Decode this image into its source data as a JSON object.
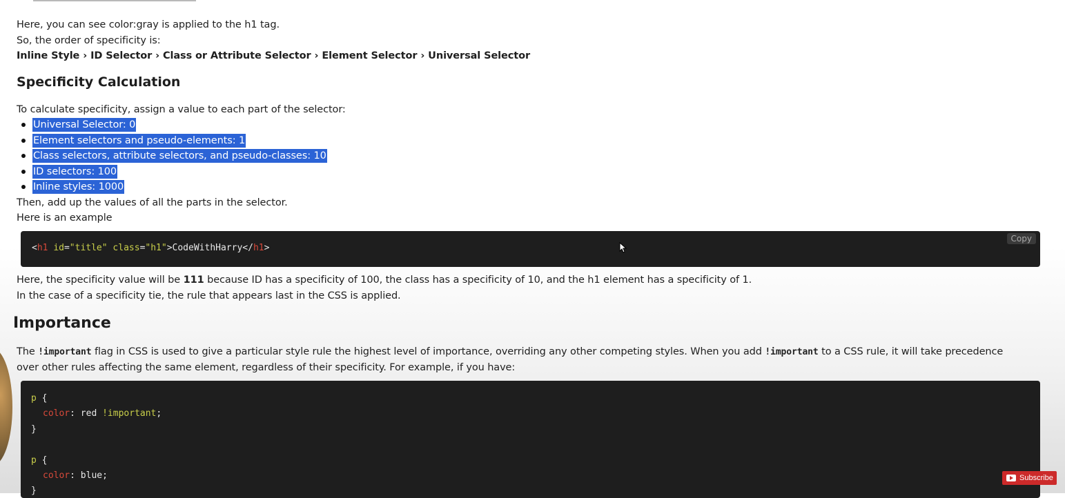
{
  "intro": {
    "line1": "Here, you can see color:gray is applied to the h1 tag.",
    "line2": "So, the order of specificity is:",
    "order": "Inline Style › ID Selector › Class or Attribute Selector › Element Selector › Universal Selector"
  },
  "specificity": {
    "heading": "Specificity Calculation",
    "intro": "To calculate specificity, assign a value to each part of the selector:",
    "items": [
      "Universal Selector: 0",
      "Element selectors and pseudo-elements: 1",
      "Class selectors, attribute selectors, and pseudo-classes: 10",
      "ID selectors: 100",
      "Inline styles: 1000"
    ],
    "then": "Then, add up the values of all the parts in the selector.",
    "example_label": "Here is an example"
  },
  "code_example": {
    "lt": "<",
    "tag": "h1",
    "attr_id": "id",
    "eq1": "=",
    "val_id": "\"title\"",
    "attr_class": "class",
    "eq2": "=",
    "val_class": "\"h1\"",
    "gt": ">",
    "text": "CodeWithHarry",
    "close_open": "</",
    "close_tag": "h1",
    "close_gt": ">",
    "copy_label": "Copy"
  },
  "explanation": {
    "part1": "Here, the specificity value will be ",
    "value": "111",
    "part2": " because ID has a specificity of 100, the class has a specificity of 10, and the h1 element has a specificity of 1.",
    "tie": "In the case of a specificity tie, the rule that appears last in the CSS is applied."
  },
  "importance": {
    "heading": "Importance",
    "p1a": "The ",
    "code1": "!important",
    "p1b": " flag in CSS is used to give a particular style rule the highest level of importance, overriding any other competing styles. When you add ",
    "code2": "!important",
    "p1c": " to a CSS rule, it will take precedence",
    "p2": "over other rules affecting the same element, regardless of their specificity. For example, if you have:"
  },
  "code_importance": {
    "l1_sel": "p",
    "l1_brace": " {",
    "l2_prop": "color",
    "l2_colon": ": red ",
    "l2_imp": "!important",
    "l2_semi": ";",
    "l3": "}",
    "l5_sel": "p",
    "l5_brace": " {",
    "l6_prop": "color",
    "l6_rest": ": blue;",
    "l7": "}"
  },
  "youtube": {
    "subscribe_label": "Subscribe"
  },
  "colors": {
    "selection": "#2b63d6",
    "code_bg": "#1e1e1e",
    "code_tag": "#d8493a",
    "code_attr": "#c9cf4a",
    "subscribe_bg": "#cc2a2a"
  }
}
